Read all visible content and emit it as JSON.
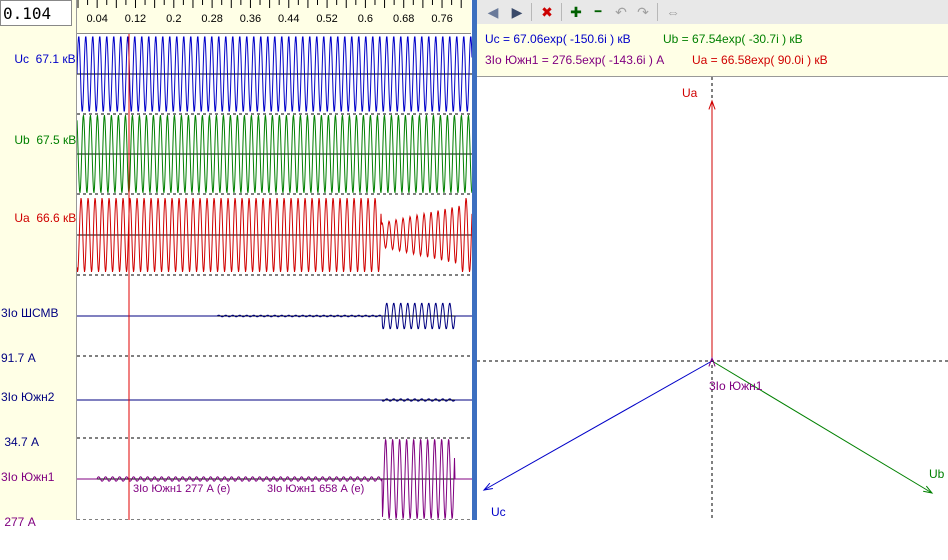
{
  "cursor_time": "0.104",
  "ruler_ticks": [
    "0.04",
    "0.12",
    "0.2",
    "0.28",
    "0.36",
    "0.44",
    "0.52",
    "0.6",
    "0.68",
    "0.76"
  ],
  "channels": [
    {
      "line1": "Uc  67.1 кВ",
      "line2": "",
      "color": "#0000c8"
    },
    {
      "line1": "Ub  67.5 кВ",
      "line2": "",
      "color": "#008000"
    },
    {
      "line1": "Ua  66.6 кВ",
      "line2": "",
      "color": "#d00000"
    },
    {
      "line1": "3Io ШСМВ",
      "line2": "91.7 А",
      "color": "#000080"
    },
    {
      "line1": "3Io Южн2",
      "line2": " 34.7 А",
      "color": "#000080"
    },
    {
      "line1": "3Io Южн1",
      "line2": " 277 А",
      "color": "#800080"
    }
  ],
  "osc_annotations": [
    "3Io Южн1 277 А (e)",
    "3Io Южн1 658 А (e)"
  ],
  "toolbar": {
    "prev": "◀",
    "next": "▶",
    "delete": "✖",
    "add": "✚",
    "remove": "━",
    "undo": "↶",
    "redo": "↷",
    "fit": "⇔"
  },
  "formulas": {
    "uc": "Uc = 67.06exp( -150.6i ) кВ",
    "ub": "Ub = 67.54exp( -30.7i ) кВ",
    "io": "3Io Южн1 = 276.5exp( -143.6i ) А",
    "ua": "Ua = 66.58exp( 90.0i ) кВ"
  },
  "vector_labels": {
    "ua": "Ua",
    "ub": "Ub",
    "uc": "Uc",
    "io": "3Io Южн1"
  },
  "colors": {
    "ua": "#d00000",
    "ub": "#008000",
    "uc": "#0000c8",
    "io": "#800080",
    "panel_bg": "#ffffe6",
    "splitter": "#3c6fc0"
  }
}
